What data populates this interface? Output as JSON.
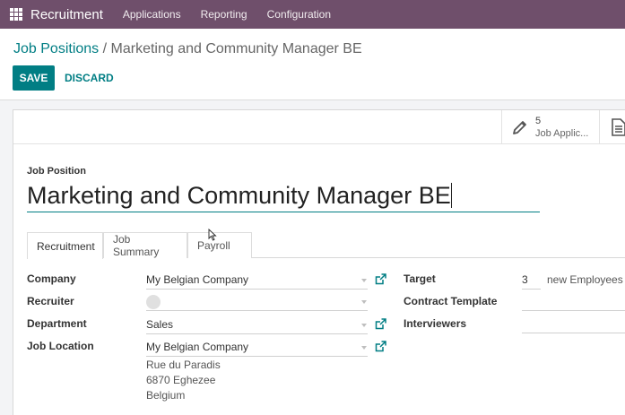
{
  "topbar": {
    "app_name": "Recruitment",
    "menu": [
      "Applications",
      "Reporting",
      "Configuration"
    ],
    "color": "#6f4f6b"
  },
  "breadcrumb": {
    "parent": "Job Positions",
    "separator": " / ",
    "current": "Marketing and Community Manager BE"
  },
  "actions": {
    "save": "SAVE",
    "discard": "DISCARD"
  },
  "smart_buttons": {
    "applications_count": "5",
    "applications_label": "Job Applic..."
  },
  "form": {
    "name_label": "Job Position",
    "name_value": "Marketing and Community Manager BE",
    "tabs": [
      "Recruitment",
      "Job Summary",
      "Payroll"
    ],
    "active_tab": "Recruitment",
    "left_fields": {
      "company_label": "Company",
      "company_value": "My Belgian Company",
      "recruiter_label": "Recruiter",
      "recruiter_value": "",
      "department_label": "Department",
      "department_value": "Sales",
      "location_label": "Job Location",
      "location_value": "My Belgian Company",
      "address": [
        "Rue du Paradis",
        "6870 Eghezee",
        "Belgium"
      ]
    },
    "right_fields": {
      "target_label": "Target",
      "target_value": "3",
      "target_unit": "new Employees",
      "contract_label": "Contract Template",
      "contract_value": "",
      "interviewers_label": "Interviewers",
      "interviewers_value": ""
    }
  },
  "colors": {
    "accent": "#017e84",
    "brand": "#6f4f6b"
  }
}
